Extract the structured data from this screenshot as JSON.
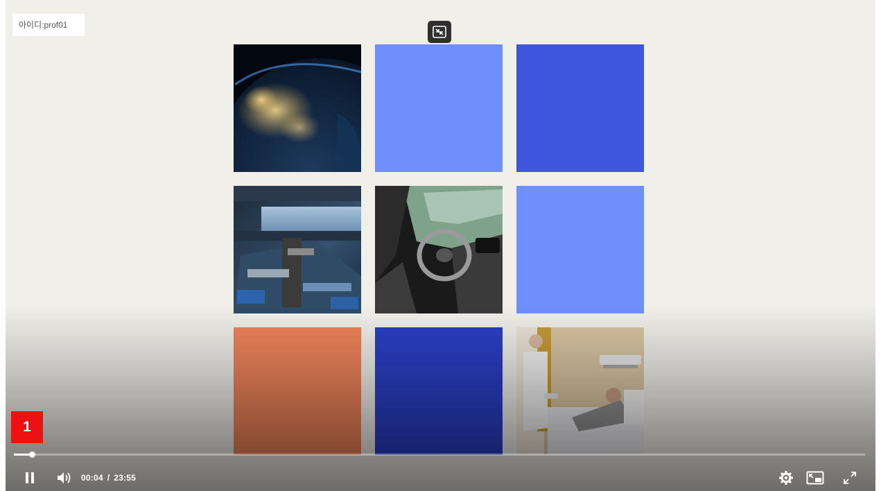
{
  "watermark": {
    "text": "아이디:prof01"
  },
  "tiles": [
    {
      "id": "earth-night-photo",
      "kind": "photo"
    },
    {
      "id": "blue-tile-1",
      "kind": "color",
      "color": "#6e8ffc"
    },
    {
      "id": "blue-tile-2",
      "kind": "color",
      "color": "#3f56dc"
    },
    {
      "id": "space-station-photo",
      "kind": "photo"
    },
    {
      "id": "car-interior-photo",
      "kind": "photo"
    },
    {
      "id": "blue-tile-3",
      "kind": "color",
      "color": "#6f90fc"
    },
    {
      "id": "orange-tile",
      "kind": "color",
      "color": "#f0845a"
    },
    {
      "id": "navy-tile",
      "kind": "color",
      "color": "#2a3fc6"
    },
    {
      "id": "hospital-photo",
      "kind": "photo"
    }
  ],
  "marker": {
    "label": "1",
    "color": "#ee1111"
  },
  "player": {
    "current_time": "00:04",
    "separator": "/",
    "duration": "23:55",
    "progress_fraction": 0.0028,
    "icons": {
      "play": "pause-icon",
      "volume": "volume-icon",
      "settings": "gear-icon",
      "pip": "picture-in-picture-icon",
      "fullscreen": "fullscreen-icon",
      "collapse": "collapse-icon"
    }
  }
}
